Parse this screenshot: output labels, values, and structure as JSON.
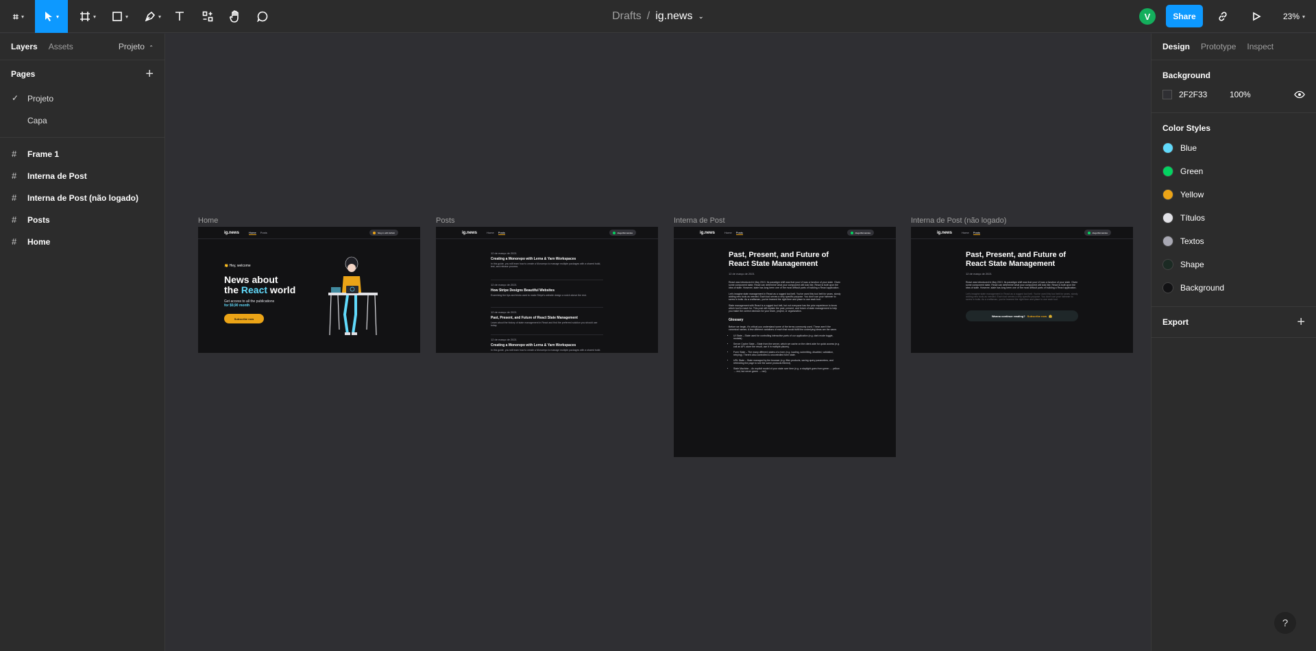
{
  "toolbar": {
    "tools": [
      "figma-menu",
      "move",
      "frame",
      "shape",
      "pen",
      "text",
      "resources",
      "hand",
      "comment"
    ],
    "file": {
      "folder": "Drafts",
      "separator": "/",
      "name": "ig.news"
    },
    "avatar_initial": "V",
    "share_label": "Share",
    "zoom": "23%"
  },
  "left_panel": {
    "tabs": [
      "Layers",
      "Assets"
    ],
    "page_dropdown": "Projeto",
    "pages_title": "Pages",
    "pages": [
      {
        "name": "Projeto",
        "selected": true
      },
      {
        "name": "Capa",
        "selected": false
      }
    ],
    "layers": [
      "Frame 1",
      "Interna de Post",
      "Interna de Post (não logado)",
      "Posts",
      "Home"
    ]
  },
  "right_panel": {
    "tabs": [
      "Design",
      "Prototype",
      "Inspect"
    ],
    "background": {
      "title": "Background",
      "hex": "2F2F33",
      "opacity": "100%"
    },
    "color_styles_title": "Color Styles",
    "color_styles": [
      {
        "name": "Blue",
        "color": "#61dafb"
      },
      {
        "name": "Green",
        "color": "#04d361"
      },
      {
        "name": "Yellow",
        "color": "#eba417"
      },
      {
        "name": "Títulos",
        "color": "#e1e1e6"
      },
      {
        "name": "Textos",
        "color": "#a8a8b3"
      },
      {
        "name": "Shape",
        "color": "#1b2a23"
      },
      {
        "name": "Background",
        "color": "#121214"
      }
    ],
    "export_title": "Export"
  },
  "help_label": "?",
  "canvas": {
    "frame_labels": [
      "Home",
      "Posts",
      "Interna de Post",
      "Interna de Post (não logado)"
    ],
    "frame_nav": {
      "logo": "ig.news",
      "home": "Home",
      "posts": "Posts",
      "pill_signed_out": "Sing in with Github",
      "pill_user": "diego3fernandes"
    },
    "home": {
      "welcome": "👏 Hey, welcome",
      "headline_1": "News about",
      "headline_2_pre": "the ",
      "headline_2_accent": "React",
      "headline_2_post": " world",
      "sub_1": "Get access to all the publications",
      "sub_2": "for $9,90 month",
      "cta": "Subscribe now"
    },
    "posts_list": [
      {
        "date": "12 de março de 2021",
        "title": "Creating a Monorepo with Lerna & Yarn Workspaces",
        "excerpt": "In this guide, you will learn how to create a Monorepo to manage multiple packages with a shared build, test, and release process."
      },
      {
        "date": "12 de março de 2021",
        "title": "How Stripe Designs Beautiful Websites",
        "excerpt": "Examining the tips and tricks used to make Stripe's website design a notch above the rest."
      },
      {
        "date": "12 de março de 2021",
        "title": "Past, Present, and Future of React State Management",
        "excerpt": "Learn about the history of state management in React and find the preferred solution you should use today."
      },
      {
        "date": "12 de março de 2021",
        "title": "Creating a Monorepo with Lerna & Yarn Workspaces",
        "excerpt": "In this guide, you will learn how to create a Monorepo to manage multiple packages with a shared build."
      }
    ],
    "post": {
      "title": "Past, Present, and Future of React State Management",
      "date": "12 de março de 2021",
      "p1": "React was introduced in May 2013. Its paradigm shift was that your UI was a function of your state. Given some component state, React can determine what your component will look like. React is built upon the idea of state. However, state has long been one of the most difficult parts of building a React application.",
      "p2": "Let's imagine state management in React as a rugged tool belt. You've used this tool belt for years, slowly adding new tools as needed. Each tool serves a very specific purpose. You don't use your hammer to screw in bolts. As a craftsman, you've learned the right time and place to use each tool.",
      "p3": "State management with React is a rugged tool belt, but not everyone has the prior experience to know which tool to reach for. This post will explain the past, present, and future of state management to help you make the correct decision for your team, project, or organization.",
      "glossary_title": "Glossary",
      "glossary_intro": "Before we begin, it's critical you understand some of the terms commonly used. These aren't the canonical names. A few different variations of each that would fulfill the underlying ideas are the same.",
      "glossary": [
        "UI State – State used for controlling interactive parts of our application (e.g. dark mode toggle, modals).",
        "Server Cache State – State from the server, which we cache on the client-side for quick access (e.g. call an API, store the result, use it in multiple places).",
        "Form State – The many different states of a form (e.g. loading, submitting, disabled, validation, retrying). There's also controlled & uncontrolled form state.",
        "URL State – State managed by the browser (e.g. filter products, saving query parameters, and refreshing the page to see the same products filtered).",
        "State Machine – An explicit model of your state over time (e.g. a stoplight goes from green → yellow → red, but never green → red)."
      ],
      "continue_reading": "Wanna continue reading?",
      "subscribe_now": "Subscribe now",
      "hug_emoji": "🤗"
    }
  }
}
